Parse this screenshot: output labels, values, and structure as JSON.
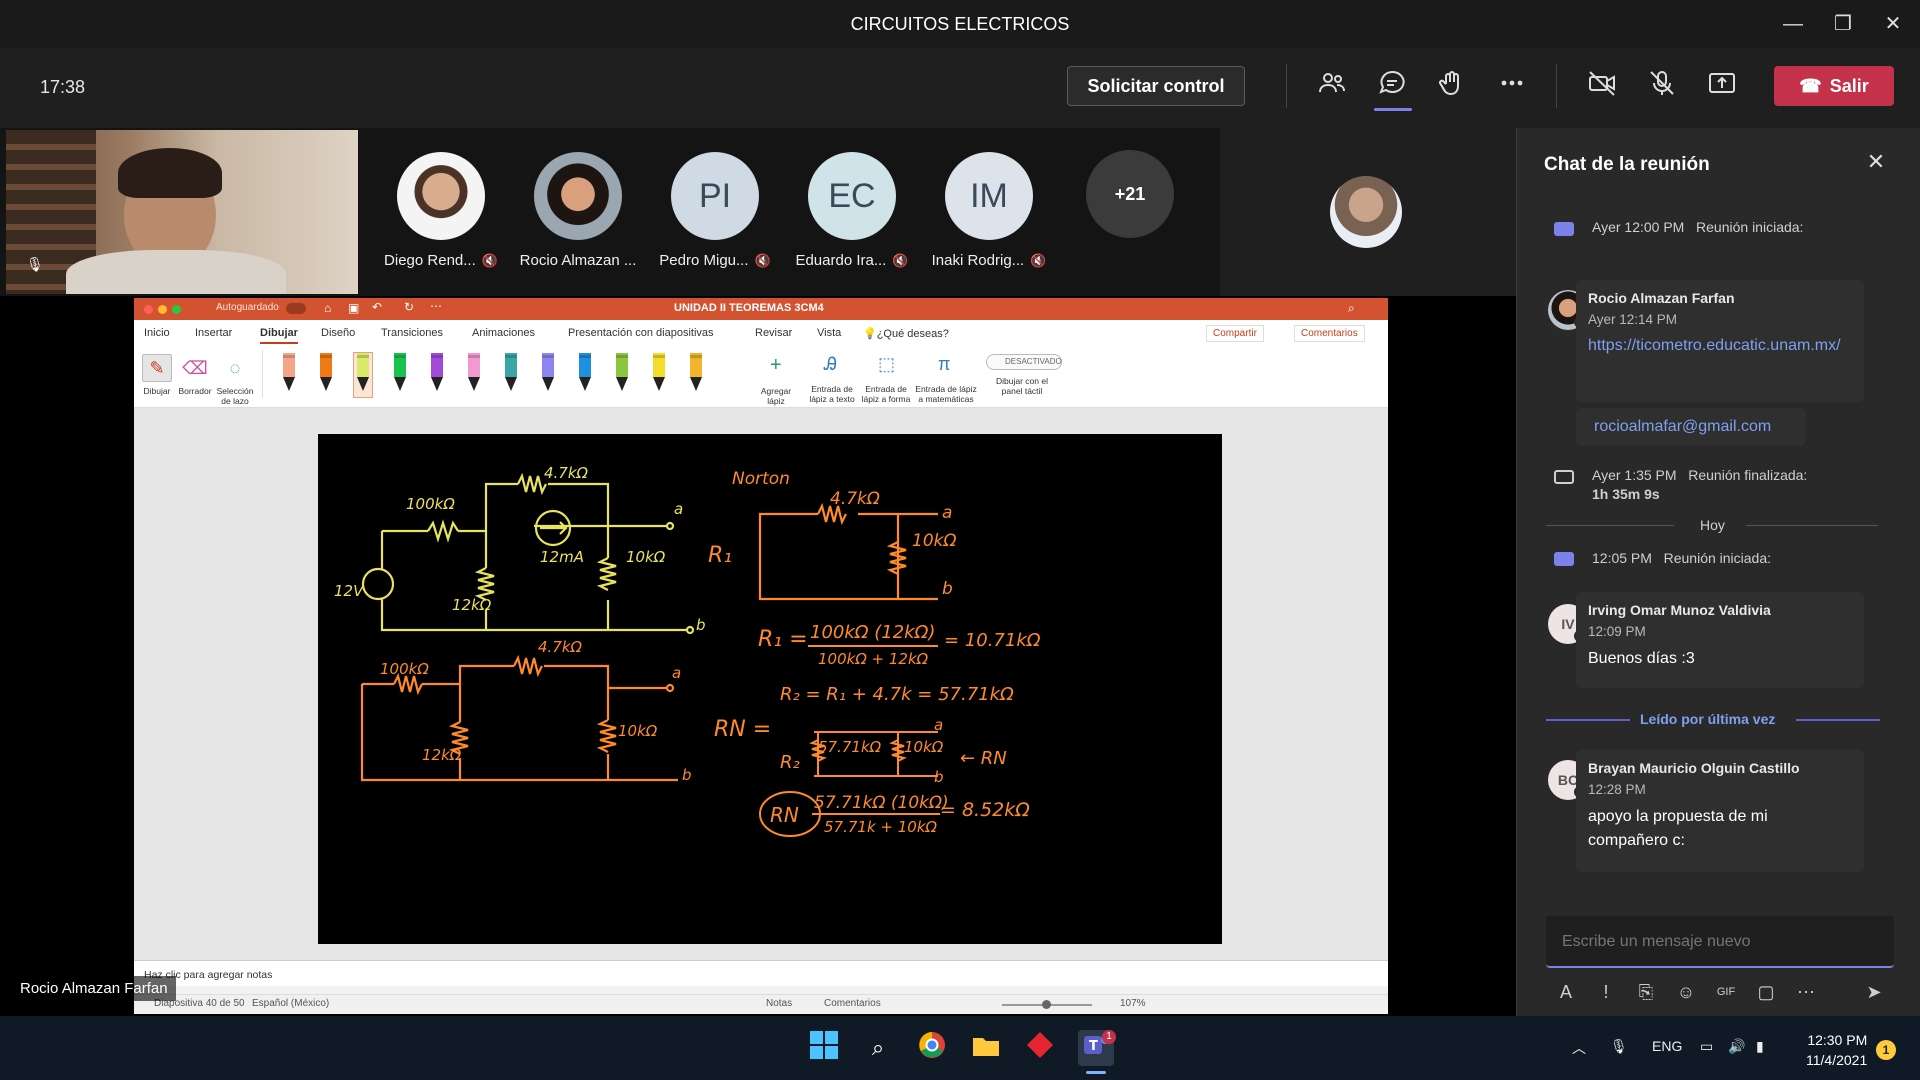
{
  "window": {
    "title": "CIRCUITOS ELECTRICOS",
    "minimize": "—",
    "restore": "❐",
    "close": "✕"
  },
  "toolbar": {
    "clock": "17:38",
    "request_control": "Solicitar control",
    "leave": "Salir",
    "icons": [
      "people-icon",
      "chat-icon",
      "raise-hand-icon",
      "more-icon",
      "camera-off-icon",
      "mic-off-icon",
      "share-icon"
    ]
  },
  "participants": [
    {
      "name": "Diego Rend...",
      "initials": ""
    },
    {
      "name": "Rocio Almazan ...",
      "initials": ""
    },
    {
      "name": "Pedro Migu...",
      "initials": "PI"
    },
    {
      "name": "Eduardo Ira...",
      "initials": "EC"
    },
    {
      "name": "Inaki Rodrig...",
      "initials": "IM"
    }
  ],
  "more_participants": "+21",
  "presenter": "Rocio Almazan Farfan",
  "ppt": {
    "autosave": "Autoguardado",
    "doc_title": "UNIDAD II TEOREMAS 3CM4",
    "tabs": [
      "Inicio",
      "Insertar",
      "Dibujar",
      "Diseño",
      "Transiciones",
      "Animaciones",
      "Presentación con diapositivas",
      "Revisar",
      "Vista",
      "¿Qué deseas?"
    ],
    "share": "Compartir",
    "comments": "Comentarios",
    "tools": {
      "draw": "Dibujar",
      "eraser": "Borrador",
      "lasso": "Selección de lazo",
      "add_pen": "Agregar lápiz",
      "ink_text": "Entrada de lápiz a texto",
      "ink_shape": "Entrada de lápiz a forma",
      "ink_math": "Entrada de lápiz a matemáticas",
      "toggle": "DESACTIVADO",
      "touch": "Dibujar con el panel táctil"
    },
    "pens": [
      "#f4a58a",
      "#f07b16",
      "#d7ea6a",
      "#19c34d",
      "#a24bd8",
      "#f29ad0",
      "#3aa6a8",
      "#8e86f0",
      "#1f8fe0",
      "#8dc63f",
      "#f4dc2a",
      "#f2b42a"
    ],
    "notes_placeholder": "Haz clic para agregar notas",
    "status": {
      "slide": "Diapositiva 40 de 50",
      "lang": "Español (México)",
      "notes": "Notas",
      "comments": "Comentarios",
      "zoom": "107%"
    }
  },
  "slide": {
    "top_circuit": {
      "r1": "100kΩ",
      "r2": "4.7kΩ",
      "r3": "12kΩ",
      "r4": "10kΩ",
      "src": "12V",
      "cur": "12mA",
      "a": "a",
      "b": "b"
    },
    "norton": {
      "title": "Norton",
      "r2": "4.7kΩ",
      "r3": "10kΩ",
      "r1": "R₁",
      "a": "a",
      "b": "b"
    },
    "eq1": "R₁ = 100kΩ (12kΩ) / 100kΩ + 12kΩ = 10.71kΩ",
    "eq1_num": "100kΩ (12kΩ)",
    "eq1_den": "100kΩ + 12kΩ",
    "eq1_res": "= 10.71kΩ",
    "eq2": "R₂ = R₁ + 4.7k = 57.71kΩ",
    "rn_label": "RN =",
    "rn_net": {
      "r2": "57.71kΩ",
      "r3": "10kΩ",
      "label": "R₂",
      "arrow": "← RN",
      "a": "a",
      "b": "b"
    },
    "eq3_num": "57.71kΩ (10kΩ)",
    "eq3_den": "57.71k + 10kΩ",
    "eq3_res": "= 8.52kΩ",
    "eq3_lhs": "RN",
    "bottom_circuit": {
      "r1": "100kΩ",
      "r2": "4.7kΩ",
      "r3": "12kΩ",
      "r4": "10kΩ",
      "a": "a",
      "b": "b"
    }
  },
  "chat": {
    "title": "Chat de la reunión",
    "sys1": {
      "time": "Ayer 12:00 PM",
      "text": "Reunión iniciada:"
    },
    "msg1": {
      "name": "Rocio Almazan Farfan",
      "time": "Ayer 12:14 PM",
      "link": "https://ticometro.educatic.unam.mx/",
      "email": "rocioalmafar@gmail.com"
    },
    "sys2": {
      "time": "Ayer 1:35 PM",
      "text": "Reunión finalizada:",
      "duration": "1h 35m 9s"
    },
    "today": "Hoy",
    "sys3": {
      "time": "12:05 PM",
      "text": "Reunión iniciada:"
    },
    "msg2": {
      "initials": "IV",
      "name": "Irving Omar Munoz Valdivia",
      "time": "12:09 PM",
      "text": "Buenos días :3"
    },
    "last_read": "Leído por última vez",
    "msg3": {
      "initials": "BC",
      "name": "Brayan Mauricio Olguin Castillo",
      "time": "12:28 PM",
      "text": "apoyo la propuesta de mi compañero c:"
    },
    "compose_placeholder": "Escribe un mensaje nuevo"
  },
  "taskbar": {
    "lang": "ENG",
    "time": "12:30 PM",
    "date": "11/4/2021",
    "notif": "1",
    "teams_badge": "1"
  }
}
